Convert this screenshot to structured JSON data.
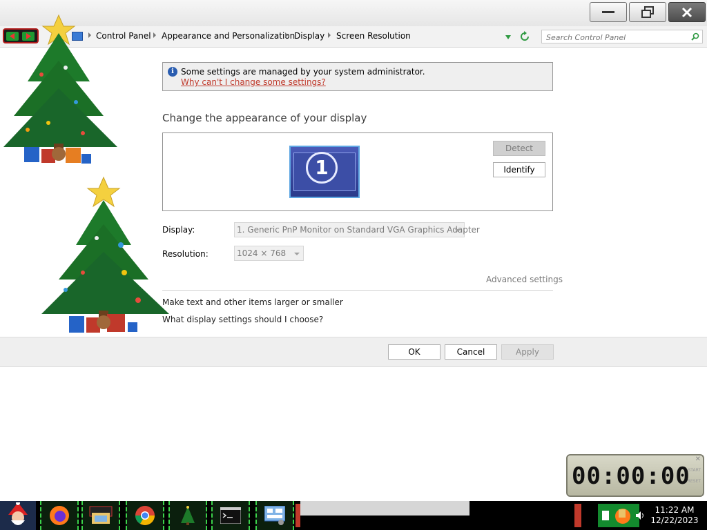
{
  "breadcrumb": [
    "Control Panel",
    "Appearance and Personalization",
    "Display",
    "Screen Resolution"
  ],
  "search": {
    "placeholder": "Search Control Panel"
  },
  "infobar": {
    "message": "Some settings are managed by your system administrator.",
    "link": "Why can't I change some settings?"
  },
  "heading": "Change the appearance of your display",
  "preview": {
    "monitor_number": "1",
    "detect_label": "Detect",
    "identify_label": "Identify"
  },
  "display": {
    "label": "Display:",
    "value": "1. Generic PnP Monitor on Standard VGA Graphics Adapter"
  },
  "resolution": {
    "label": "Resolution:",
    "value": "1024 × 768"
  },
  "advanced_link": "Advanced settings",
  "links": {
    "text_size": "Make text and other items larger or smaller",
    "help": "What display settings should I choose?"
  },
  "footer": {
    "ok": "OK",
    "cancel": "Cancel",
    "apply": "Apply"
  },
  "timer": {
    "display": "00:00:00",
    "start": "START",
    "reset": "RESET"
  },
  "clock": {
    "time": "11:22 AM",
    "date": "12/22/2023"
  },
  "colors": {
    "accent_green": "#3bd24a",
    "link_red": "#c0392b",
    "info_blue": "#2a5db0"
  }
}
